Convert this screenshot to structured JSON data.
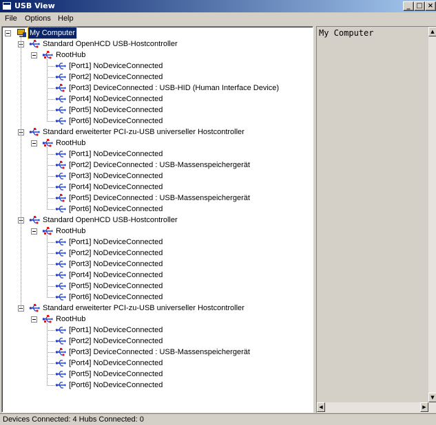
{
  "window": {
    "title": "USB View"
  },
  "menu": {
    "file": "File",
    "options": "Options",
    "help": "Help"
  },
  "tree": {
    "root": "My Computer",
    "controllers": [
      {
        "label": "Standard OpenHCD USB-Hostcontroller",
        "hub": "RootHub",
        "ports": [
          {
            "label": "[Port1] NoDeviceConnected",
            "connected": false
          },
          {
            "label": "[Port2] NoDeviceConnected",
            "connected": false
          },
          {
            "label": "[Port3] DeviceConnected :  USB-HID (Human Interface Device)",
            "connected": true
          },
          {
            "label": "[Port4] NoDeviceConnected",
            "connected": false
          },
          {
            "label": "[Port5] NoDeviceConnected",
            "connected": false
          },
          {
            "label": "[Port6] NoDeviceConnected",
            "connected": false
          }
        ]
      },
      {
        "label": "Standard erweiterter PCI-zu-USB universeller Hostcontroller",
        "hub": "RootHub",
        "ports": [
          {
            "label": "[Port1] NoDeviceConnected",
            "connected": false
          },
          {
            "label": "[Port2] DeviceConnected :  USB-Massenspeichergerät",
            "connected": true
          },
          {
            "label": "[Port3] NoDeviceConnected",
            "connected": false
          },
          {
            "label": "[Port4] NoDeviceConnected",
            "connected": false
          },
          {
            "label": "[Port5] DeviceConnected :  USB-Massenspeichergerät",
            "connected": true
          },
          {
            "label": "[Port6] NoDeviceConnected",
            "connected": false
          }
        ]
      },
      {
        "label": "Standard OpenHCD USB-Hostcontroller",
        "hub": "RootHub",
        "ports": [
          {
            "label": "[Port1] NoDeviceConnected",
            "connected": false
          },
          {
            "label": "[Port2] NoDeviceConnected",
            "connected": false
          },
          {
            "label": "[Port3] NoDeviceConnected",
            "connected": false
          },
          {
            "label": "[Port4] NoDeviceConnected",
            "connected": false
          },
          {
            "label": "[Port5] NoDeviceConnected",
            "connected": false
          },
          {
            "label": "[Port6] NoDeviceConnected",
            "connected": false
          }
        ]
      },
      {
        "label": "Standard erweiterter PCI-zu-USB universeller Hostcontroller",
        "hub": "RootHub",
        "ports": [
          {
            "label": "[Port1] NoDeviceConnected",
            "connected": false
          },
          {
            "label": "[Port2] NoDeviceConnected",
            "connected": false
          },
          {
            "label": "[Port3] DeviceConnected :  USB-Massenspeichergerät",
            "connected": true
          },
          {
            "label": "[Port4] NoDeviceConnected",
            "connected": false
          },
          {
            "label": "[Port5] NoDeviceConnected",
            "connected": false
          },
          {
            "label": "[Port6] NoDeviceConnected",
            "connected": false
          }
        ]
      }
    ]
  },
  "detail": {
    "text": "My Computer"
  },
  "status": {
    "text": "Devices Connected: 4   Hubs Connected: 0"
  },
  "colors": {
    "title_start": "#0a246a",
    "title_end": "#a6caf0",
    "usb_blue": "#1f3fd6",
    "usb_red": "#d02020",
    "selection": "#0a246a"
  },
  "icons": {
    "computer": "computer-icon",
    "controller": "usb-controller-icon",
    "hub": "usb-hub-icon",
    "port": "usb-port-icon",
    "device": "usb-device-icon"
  }
}
